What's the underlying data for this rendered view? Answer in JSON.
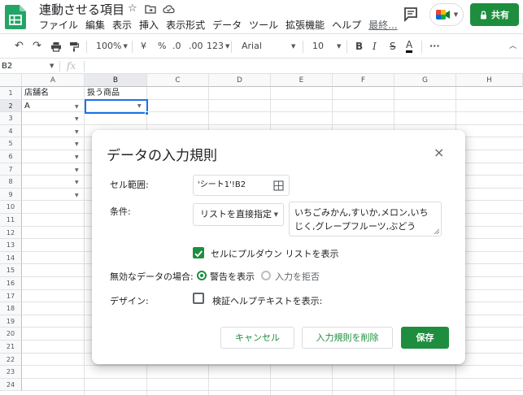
{
  "title_bar": {
    "doc_title": "連動させる項目",
    "menu": [
      "ファイル",
      "編集",
      "表示",
      "挿入",
      "表示形式",
      "データ",
      "ツール",
      "拡張機能",
      "ヘルプ"
    ],
    "last_edit": "最終...",
    "share_label": "共有"
  },
  "toolbar": {
    "zoom": "100%",
    "currency": "¥",
    "percent": "%",
    "decimal_decrease": ".0",
    "decimal_increase": ".00",
    "number_format": "123",
    "font": "Arial",
    "font_size": "10",
    "bold": "B",
    "italic": "I",
    "strikethrough": "S",
    "text_color": "A",
    "more": "···"
  },
  "formula_bar": {
    "cell_ref": "B2",
    "fx": "fx"
  },
  "grid": {
    "columns": [
      "A",
      "B",
      "C",
      "D",
      "E",
      "F",
      "G",
      "H"
    ],
    "rows": [
      "1",
      "2",
      "3",
      "4",
      "5",
      "6",
      "7",
      "8",
      "9",
      "10",
      "11",
      "12",
      "13",
      "14",
      "15",
      "16",
      "17",
      "18",
      "19",
      "20",
      "21",
      "22",
      "23",
      "24"
    ],
    "cells": {
      "A1": "店舗名",
      "B1": "扱う商品",
      "A2": "A"
    }
  },
  "dialog": {
    "title": "データの入力規則",
    "close": "×",
    "range_label": "セル範囲:",
    "range_value": "'シート1'!B2",
    "criteria_label": "条件:",
    "criteria_type": "リストを直接指定",
    "criteria_values": "いちごみかん,すいか,メロン,いちじく,グレープフルーツ,ぶどう",
    "show_dropdown_label": "セルにプルダウン リストを表示",
    "invalid_label": "無効なデータの場合:",
    "warn_label": "警告を表示",
    "reject_label": "入力を拒否",
    "design_label": "デザイン:",
    "help_text_label": "検証ヘルプテキストを表示:",
    "cancel": "キャンセル",
    "remove": "入力規則を削除",
    "save": "保存"
  },
  "colors": {
    "accent_green": "#1e8e3e",
    "selection_blue": "#1a73e8"
  }
}
